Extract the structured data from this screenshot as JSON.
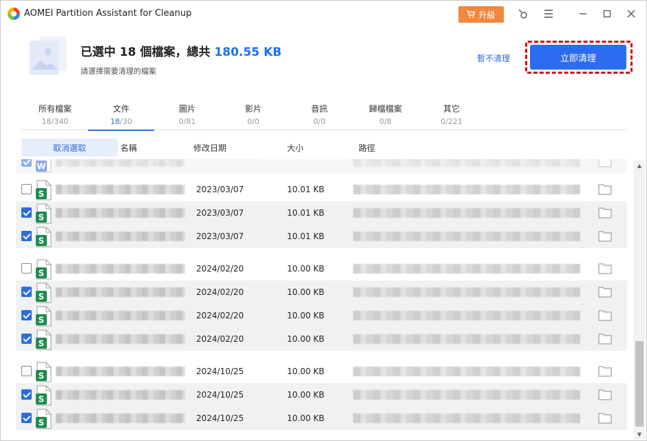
{
  "window": {
    "title": "AOMEI Partition Assistant for Cleanup",
    "upgrade_label": "升級"
  },
  "header": {
    "title_prefix": "已選中 18 個檔案，總共 ",
    "total_size": "180.55 KB",
    "subtitle": "請選擇需要清理的檔案",
    "skip_label": "暫不清理",
    "clean_label": "立即清理"
  },
  "tabs": [
    {
      "label": "所有檔案",
      "selected": "18",
      "total": "/340",
      "active": false
    },
    {
      "label": "文件",
      "selected": "18",
      "total": "/30",
      "active": true
    },
    {
      "label": "圖片",
      "selected": "0",
      "total": "/81",
      "active": false
    },
    {
      "label": "影片",
      "selected": "0",
      "total": "/0",
      "active": false
    },
    {
      "label": "音訊",
      "selected": "0",
      "total": "/0",
      "active": false
    },
    {
      "label": "歸檔檔案",
      "selected": "0",
      "total": "/8",
      "active": false
    },
    {
      "label": "其它",
      "selected": "0",
      "total": "/221",
      "active": false
    }
  ],
  "columns": {
    "deselect_label": "取消選取",
    "name": "名稱",
    "date": "修改日期",
    "size": "大小",
    "path": "路徑"
  },
  "rows": [
    {
      "checked": true,
      "type": "word",
      "date": "",
      "size": "",
      "partial": true
    },
    {
      "checked": false,
      "type": "sheet",
      "date": "2023/03/07",
      "size": "10.01 KB"
    },
    {
      "checked": true,
      "type": "sheet",
      "date": "2023/03/07",
      "size": "10.01 KB"
    },
    {
      "checked": true,
      "type": "sheet",
      "date": "2023/03/07",
      "size": "10.01 KB"
    },
    {
      "checked": false,
      "type": "sheet",
      "date": "2024/02/20",
      "size": "10.00 KB"
    },
    {
      "checked": true,
      "type": "sheet",
      "date": "2024/02/20",
      "size": "10.00 KB"
    },
    {
      "checked": true,
      "type": "sheet",
      "date": "2024/02/20",
      "size": "10.00 KB"
    },
    {
      "checked": true,
      "type": "sheet",
      "date": "2024/02/20",
      "size": "10.00 KB"
    },
    {
      "checked": false,
      "type": "sheet",
      "date": "2024/10/25",
      "size": "10.00 KB"
    },
    {
      "checked": true,
      "type": "sheet",
      "date": "2024/10/25",
      "size": "10.00 KB"
    },
    {
      "checked": true,
      "type": "sheet",
      "date": "2024/10/25",
      "size": "10.00 KB"
    }
  ],
  "colors": {
    "accent": "#2d6cdf",
    "upgrade": "#f0883e",
    "sheet_icon": "#1e8c4e",
    "word_icon": "#2b5fd8",
    "highlight_frame": "#d0021b"
  },
  "icons": {
    "app": "aomei-logo-icon",
    "cart": "cart-icon",
    "feedback": "feedback-icon",
    "menu": "menu-icon",
    "minimize": "minimize-icon",
    "maximize": "maximize-icon",
    "close": "close-icon",
    "folder": "folder-icon",
    "sheet_letter": "S",
    "word_letter": "W"
  }
}
